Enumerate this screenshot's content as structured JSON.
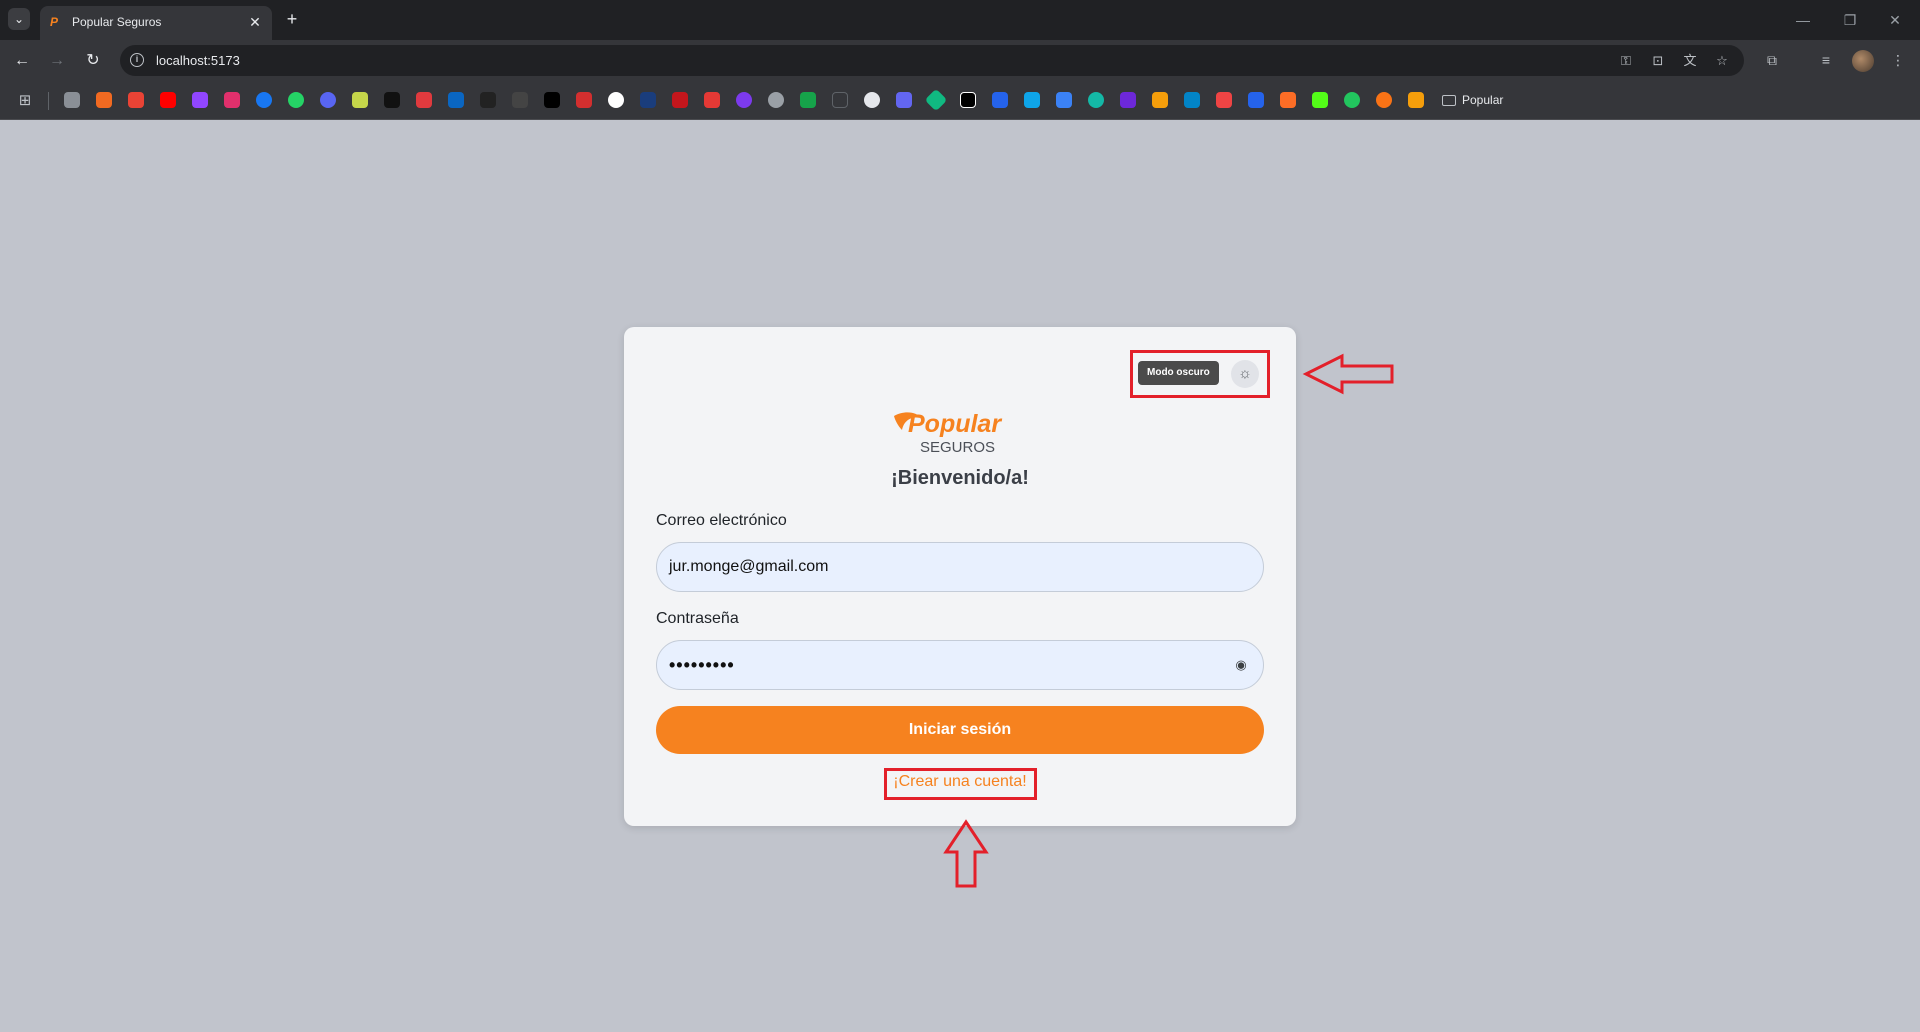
{
  "browser": {
    "tab_title": "Popular Seguros",
    "url": "localhost:5173",
    "bookmark_folder": "Popular"
  },
  "login": {
    "theme_tooltip": "Modo oscuro",
    "brand_name": "Popular",
    "brand_sub": "SEGUROS",
    "welcome": "¡Bienvenido/a!",
    "email_label": "Correo electrónico",
    "email_value": "jur.monge@gmail.com",
    "password_label": "Contraseña",
    "password_value": "•••••••••",
    "submit_label": "Iniciar sesión",
    "create_account_label": "¡Crear una cuenta!"
  },
  "colors": {
    "brand_orange": "#f6821f",
    "annotation_red": "#e3202a",
    "page_background": "#c1c4cc",
    "card_background": "#f3f4f6"
  },
  "icons": {
    "theme_toggle": "sun-icon",
    "password_visibility": "eye-icon"
  }
}
